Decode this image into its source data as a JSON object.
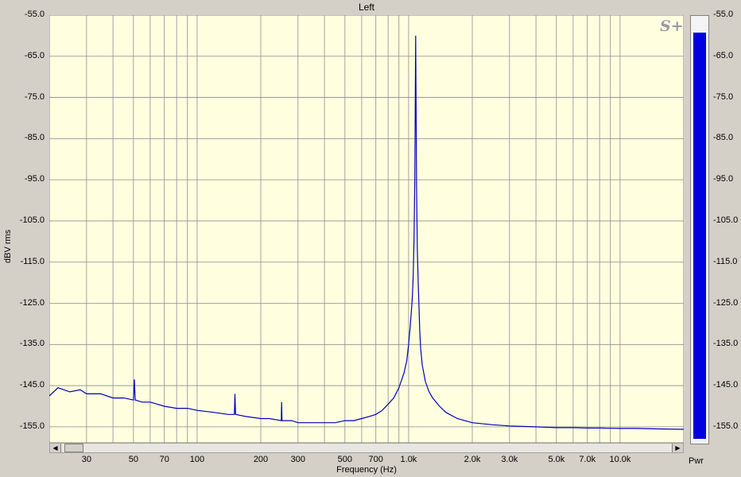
{
  "chart_data": {
    "type": "line",
    "title": "Left",
    "xlabel": "Frequency (Hz)",
    "ylabel": "dBV rms",
    "xscale": "log",
    "xlim": [
      20,
      20000
    ],
    "ylim": [
      -160,
      -55
    ],
    "yticks": [
      "-55.0",
      "-65.0",
      "-75.0",
      "-85.0",
      "-95.0",
      "-105.0",
      "-115.0",
      "-125.0",
      "-135.0",
      "-145.0",
      "-155.0"
    ],
    "xticks": [
      {
        "v": 30,
        "label": "30"
      },
      {
        "v": 50,
        "label": "50"
      },
      {
        "v": 70,
        "label": "70"
      },
      {
        "v": 100,
        "label": "100"
      },
      {
        "v": 200,
        "label": "200"
      },
      {
        "v": 300,
        "label": "300"
      },
      {
        "v": 500,
        "label": "500"
      },
      {
        "v": 700,
        "label": "700"
      },
      {
        "v": 1000,
        "label": "1.0k"
      },
      {
        "v": 2000,
        "label": "2.0k"
      },
      {
        "v": 3000,
        "label": "3.0k"
      },
      {
        "v": 5000,
        "label": "5.0k"
      },
      {
        "v": 7000,
        "label": "7.0k"
      },
      {
        "v": 10000,
        "label": "10.0k"
      }
    ],
    "grid": true,
    "colors": {
      "plot_bg": "#ffffe0",
      "grid": "#8c8c8c",
      "line": "#0000c0"
    },
    "series": [
      {
        "name": "",
        "x": [
          20,
          22,
          25,
          28,
          30,
          35,
          40,
          45,
          50,
          50.5,
          51,
          55,
          60,
          70,
          80,
          90,
          100,
          120,
          140,
          150,
          151,
          152,
          170,
          200,
          220,
          250,
          251,
          252,
          280,
          300,
          350,
          400,
          450,
          500,
          550,
          600,
          650,
          700,
          750,
          800,
          850,
          900,
          950,
          980,
          1000,
          1020,
          1040,
          1050,
          1060,
          1070,
          1080,
          1090,
          1100,
          1110,
          1120,
          1130,
          1140,
          1160,
          1200,
          1250,
          1300,
          1400,
          1500,
          1700,
          2000,
          2500,
          3000,
          4000,
          5000,
          6000,
          7000,
          8000,
          10000,
          12000,
          15000,
          20000
        ],
        "y": [
          -147.5,
          -145.5,
          -146.5,
          -146,
          -147,
          -147,
          -148,
          -148,
          -148.5,
          -143.5,
          -148.5,
          -149,
          -149,
          -150,
          -150.5,
          -150.5,
          -151,
          -151.5,
          -152,
          -152,
          -147,
          -152,
          -152.5,
          -153,
          -153,
          -153.5,
          -149,
          -153.5,
          -153.5,
          -154,
          -154,
          -154,
          -154,
          -153.5,
          -153.5,
          -153,
          -152.5,
          -152,
          -151,
          -149.5,
          -148,
          -145.5,
          -142,
          -139,
          -135,
          -130,
          -124,
          -119,
          -110,
          -95,
          -60,
          -96,
          -112,
          -120,
          -126,
          -132,
          -136,
          -140,
          -144,
          -146.5,
          -148,
          -150,
          -151.5,
          -153,
          -154,
          -154.5,
          -154.8,
          -155,
          -155.2,
          -155.2,
          -155.3,
          -155.3,
          -155.4,
          -155.4,
          -155.5,
          -155.6
        ]
      }
    ]
  },
  "meter": {
    "label": "Pwr",
    "value_db": -59,
    "color": "#0000e0"
  },
  "logo_text": "S+",
  "scrollbar": {
    "left_arrow": "◀",
    "right_arrow": "▶"
  }
}
